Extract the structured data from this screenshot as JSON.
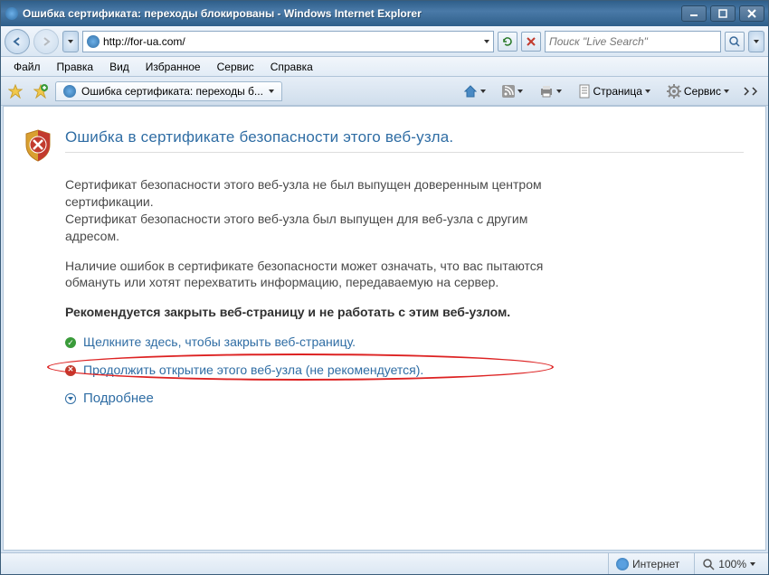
{
  "window": {
    "title": "Ошибка сертификата: переходы блокированы - Windows Internet Explorer"
  },
  "nav": {
    "url": "http://for-ua.com/"
  },
  "search": {
    "placeholder": "Поиск \"Live Search\""
  },
  "menu": {
    "file": "Файл",
    "edit": "Правка",
    "view": "Вид",
    "favorites": "Избранное",
    "tools": "Сервис",
    "help": "Справка"
  },
  "tab": {
    "label": "Ошибка сертификата: переходы б..."
  },
  "toolbar": {
    "page": "Страница",
    "tools": "Сервис"
  },
  "cert": {
    "title": "Ошибка в сертификате безопасности этого веб-узла.",
    "p1": "Сертификат безопасности этого веб-узла не был выпущен доверенным центром сертификации.",
    "p2": "Сертификат безопасности этого веб-узла был выпущен для веб-узла с другим адресом.",
    "p3": "Наличие ошибок в сертификате безопасности может означать, что вас пытаются обмануть или хотят перехватить информацию, передаваемую на сервер.",
    "recommend": "Рекомендуется закрыть веб-страницу и не работать с этим веб-узлом.",
    "link_close": "Щелкните здесь, чтобы закрыть веб-страницу.",
    "link_continue": "Продолжить открытие этого веб-узла (не рекомендуется).",
    "link_more": "Подробнее"
  },
  "status": {
    "zone": "Интернет",
    "zoom": "100%"
  }
}
